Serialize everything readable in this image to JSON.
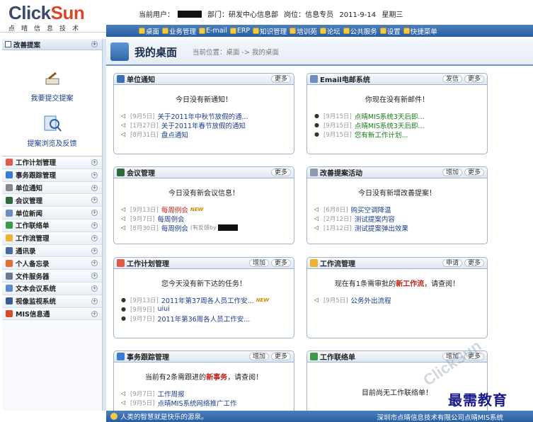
{
  "app": {
    "brand_prefix": "Click",
    "brand_suffix": "Sun",
    "tagline": "点晴信息技术"
  },
  "user": {
    "current_label": "当前用户：",
    "dept_label": "部门：研发中心信息部",
    "post_label": "岗位：信息专员",
    "date": "2011-9-14",
    "weekday": "星期三"
  },
  "nav": [
    "桌面",
    "业务管理",
    "E-mail",
    "ERP",
    "知识管理",
    "培训苑",
    "论坛",
    "公共服务",
    "设置",
    "快捷菜单"
  ],
  "sidebar": {
    "header": "改善提案",
    "submit": "我要提交提案",
    "browse": "提案浏览及反馈",
    "items": [
      "工作计划管理",
      "事务跟踪管理",
      "单位通知",
      "会议管理",
      "单位新闻",
      "工作联络单",
      "工作流管理",
      "通讯录",
      "个人备忘录",
      "文件服务器",
      "文本会议系统",
      "视像监视系统",
      "MIS信息通"
    ]
  },
  "desk": {
    "title": "我的桌面",
    "crumb": "当前位置：桌面 -> 我的桌面"
  },
  "panels": {
    "notice": {
      "title": "单位通知",
      "more": "更多",
      "msg": "今日没有新通知！",
      "rows": [
        {
          "date": "[9月5日]",
          "text": "关于2011年中秋节放假的通..."
        },
        {
          "date": "[1月27日]",
          "text": "关于2011年春节放假的通知"
        },
        {
          "date": "[8月31日]",
          "text": "盘点通知"
        }
      ]
    },
    "email": {
      "title": "Email电邮系统",
      "send": "发信",
      "more": "更多",
      "msg": "你现在没有新邮件！",
      "rows": [
        {
          "date": "[9月15日]",
          "text": "点晴MIS系统3天后即..."
        },
        {
          "date": "[9月15日]",
          "text": "点晴MIS系统3天后即..."
        },
        {
          "date": "[9月15日]",
          "text": "您有新工作计划..."
        }
      ]
    },
    "meeting": {
      "title": "会议管理",
      "more": "更多",
      "msg": "今日没有新会议信息！",
      "rows": [
        {
          "date": "[9月13日]",
          "text": "每周例会",
          "new": "NEW"
        },
        {
          "date": "[9月7日]",
          "text": "每周例会"
        },
        {
          "date": "[8月30日]",
          "text": "每周例会",
          "sub": "(有反馈by"
        }
      ]
    },
    "proposal": {
      "title": "改善提案活动",
      "add": "增加",
      "more": "更多",
      "msg": "今日没有新增改善提案！",
      "rows": [
        {
          "date": "[6月8日]",
          "text": "购买空调降温"
        },
        {
          "date": "[2月12日]",
          "text": "测试提案内容"
        },
        {
          "date": "[1月12日]",
          "text": "测试提案弹出效果"
        }
      ]
    },
    "plan": {
      "title": "工作计划管理",
      "add": "增加",
      "more": "更多",
      "msg": "您今天没有新下达的任务！",
      "rows": [
        {
          "date": "[9月13日]",
          "text": "2011年第37周各人员工作安...",
          "new": "NEW"
        },
        {
          "date": "[9月9日]",
          "text": "uiui"
        },
        {
          "date": "[9月7日]",
          "text": "2011年第36周各人员工作安..."
        }
      ]
    },
    "workflow": {
      "title": "工作流管理",
      "apply": "申请",
      "more": "更多",
      "msg_pre": "现在有1条需审批的",
      "msg_hl": "新工作流",
      "msg_post": "，请查阅！",
      "rows": [
        {
          "date": "[9月5日]",
          "text": "公务外出流程"
        }
      ]
    },
    "track": {
      "title": "事务跟踪管理",
      "add": "增加",
      "more": "更多",
      "msg_pre": "当前有2条需跟进的",
      "msg_hl": "新事务",
      "msg_post": "，请查阅！",
      "rows": [
        {
          "date": "[9月7日]",
          "text": "工作周报"
        },
        {
          "date": "[9月5日]",
          "text": "点晴MIS系统网络推广工作"
        }
      ]
    },
    "contact": {
      "title": "工作联络单",
      "add": "增加",
      "more": "更多",
      "msg": "目前尚无工作联络单！"
    }
  },
  "status": {
    "tip": "人类的智慧就是快乐的源泉。",
    "company": "深圳市点晴信息技术有限公司点晴MIS系统"
  },
  "watermark": "最需教育",
  "colors": {
    "accent": "#2b5e9f",
    "link": "#1a3d8a",
    "highlight": "#c0221a",
    "brand": "#d8472a"
  }
}
